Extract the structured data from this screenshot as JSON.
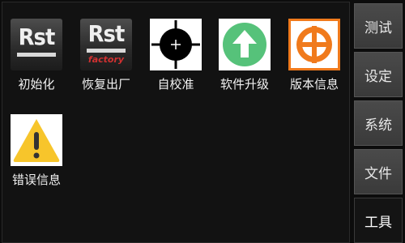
{
  "apps": [
    {
      "id": "init",
      "label": "初始化",
      "icon_text": "Rst",
      "icon": "rst-icon"
    },
    {
      "id": "factory-reset",
      "label": "恢复出厂",
      "icon_text": "Rst",
      "icon_subtext": "factory",
      "icon": "rst-factory-icon"
    },
    {
      "id": "self-calibrate",
      "label": "自校准",
      "icon": "crosshair-target-icon"
    },
    {
      "id": "software-upgrade",
      "label": "软件升级",
      "icon": "up-arrow-icon"
    },
    {
      "id": "version-info",
      "label": "版本信息",
      "icon": "version-info-icon"
    },
    {
      "id": "error-info",
      "label": "错误信息",
      "icon": "warning-icon"
    }
  ],
  "sidebar": {
    "items": [
      {
        "label": "测试"
      },
      {
        "label": "设定"
      },
      {
        "label": "系统"
      },
      {
        "label": "文件"
      },
      {
        "label": "工具",
        "active": true
      }
    ]
  },
  "colors": {
    "background": "#121212",
    "upgrade_green": "#56c27a",
    "version_orange": "#f07a1c",
    "warning_yellow": "#f7c52b",
    "factory_red": "#d03030"
  }
}
